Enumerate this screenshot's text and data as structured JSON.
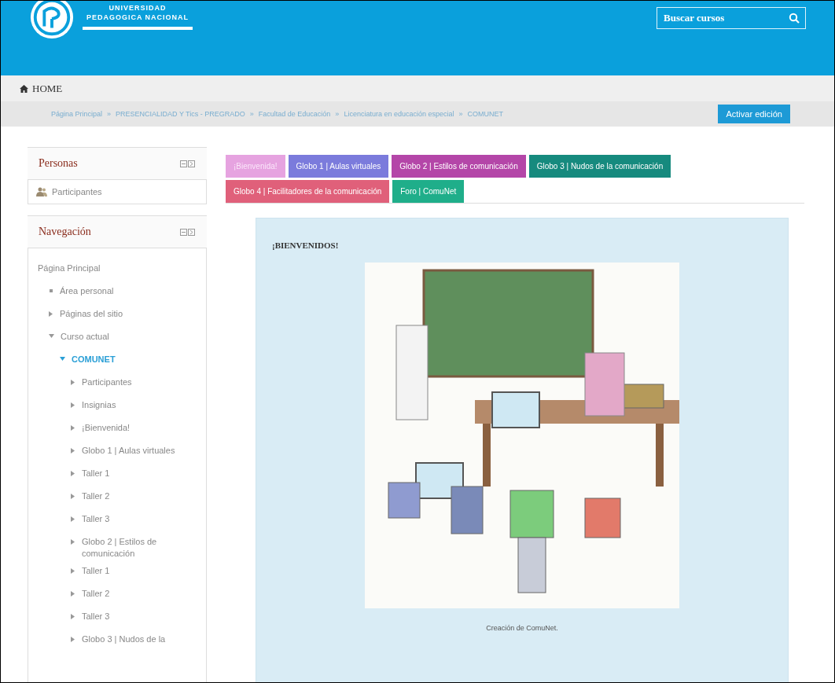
{
  "header": {
    "logo_text": "UNIVERSIDAD PEDAGOGICA NACIONAL",
    "search": {
      "placeholder": "Buscar cursos"
    }
  },
  "home_bar": {
    "label": "HOME"
  },
  "breadcrumb": {
    "items": [
      "Página Principal",
      "PRESENCIALIDAD Y Tics - PREGRADO",
      "Facultad de Educación",
      "Licenciatura en educación especial",
      "COMUNET"
    ],
    "separator": "»",
    "button": "Activar edición"
  },
  "sidebar": {
    "blocks": [
      {
        "title": "Personas",
        "kind": "list",
        "items": [
          {
            "label": "Participantes"
          }
        ]
      },
      {
        "title": "Navegación",
        "kind": "tree",
        "items": [
          {
            "label": "Página Principal",
            "children": [
              {
                "label": "Área personal"
              },
              {
                "label": "Páginas del sitio",
                "expanded": false
              },
              {
                "label": "Curso actual",
                "expanded": true,
                "children": [
                  {
                    "label": "COMUNET",
                    "expanded": true,
                    "selected": true,
                    "children": [
                      {
                        "label": "Participantes",
                        "expanded": false
                      },
                      {
                        "label": "Insignias",
                        "expanded": false
                      },
                      {
                        "label": "¡Bienvenida!",
                        "expanded": false
                      },
                      {
                        "label": "Globo 1 | Aulas virtuales",
                        "expanded": false
                      },
                      {
                        "label": "Taller 1",
                        "expanded": false
                      },
                      {
                        "label": "Taller 2",
                        "expanded": false
                      },
                      {
                        "label": "Taller 3",
                        "expanded": false
                      },
                      {
                        "label": "Globo 2 | Estilos de comunicación",
                        "expanded": false
                      },
                      {
                        "label": "Taller 1",
                        "expanded": false
                      },
                      {
                        "label": "Taller 2",
                        "expanded": false
                      },
                      {
                        "label": "Taller 3",
                        "expanded": false
                      },
                      {
                        "label": "Globo 3 | Nudos de la",
                        "expanded": false
                      }
                    ]
                  }
                ]
              }
            ]
          }
        ]
      }
    ]
  },
  "tabs": [
    {
      "label": "¡Bienvenida!",
      "selected": true,
      "color": "#e6a3e0"
    },
    {
      "label": "Globo 1 | Aulas virtuales",
      "selected": false,
      "color": "#7b7bdc"
    },
    {
      "label": "Globo 2 | Estilos de comunicación",
      "selected": false,
      "color": "#b446a8"
    },
    {
      "label": "Globo 3 | Nudos de la comunicación",
      "selected": false,
      "color": "#168a7e"
    },
    {
      "label": "Globo 4 | Facilitadores de la comunicación",
      "selected": false,
      "color": "#e0607a"
    },
    {
      "label": "Foro | ComuNet",
      "selected": false,
      "color": "#1fae8a"
    }
  ],
  "content": {
    "heading": "¡BIENVENIDOS!",
    "caption": "Creación de  ComuNet."
  }
}
